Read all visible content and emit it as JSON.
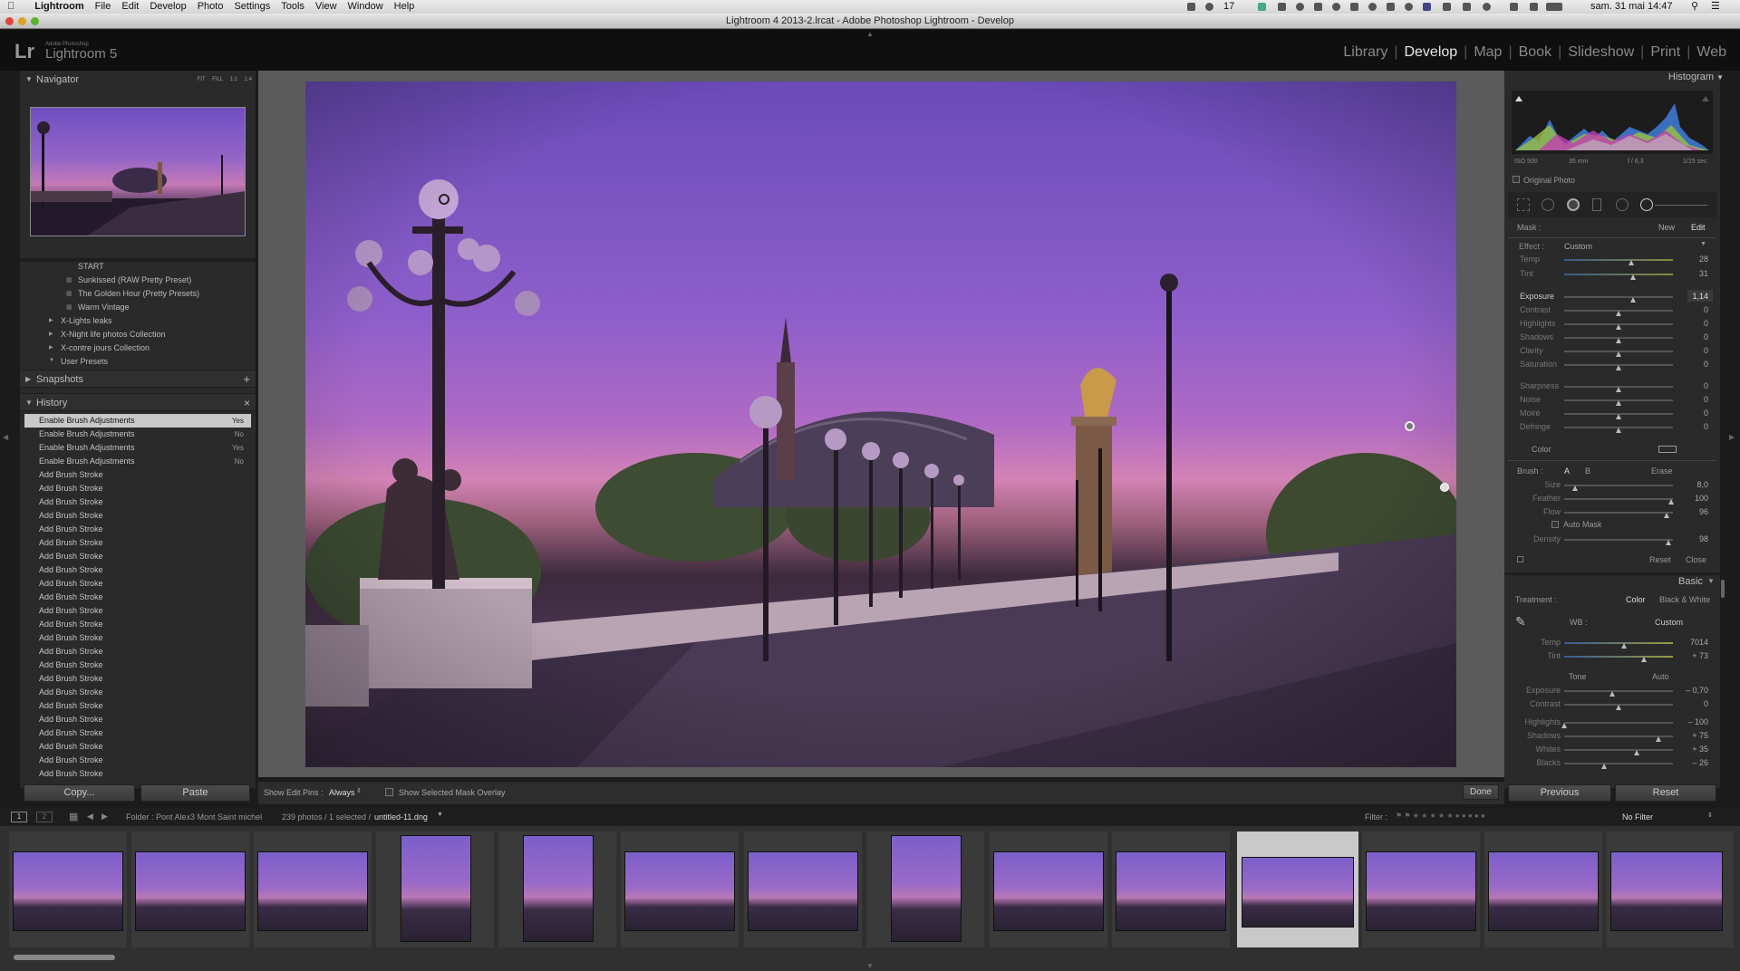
{
  "menubar": {
    "app": "Lightroom",
    "items": [
      "File",
      "Edit",
      "Develop",
      "Photo",
      "Settings",
      "Tools",
      "View",
      "Window",
      "Help"
    ],
    "badge": "17",
    "clock": "sam. 31 mai  14:47"
  },
  "window": {
    "title": "Lightroom 4 2013-2.lrcat - Adobe Photoshop Lightroom - Develop"
  },
  "header": {
    "logo_mark": "Lr",
    "logo_small": "Adobe Photoshop",
    "logo_name": "Lightroom 5",
    "modules": [
      "Library",
      "Develop",
      "Map",
      "Book",
      "Slideshow",
      "Print",
      "Web"
    ],
    "active_module": "Develop"
  },
  "left": {
    "navigator": {
      "title": "Navigator",
      "zoom_options": [
        "FIT",
        "FILL",
        "1:1",
        "1:4"
      ]
    },
    "presets": {
      "items": [
        "START",
        "Sunkissed (RAW Pretty Preset)",
        "The Golden Hour (Pretty Presets)",
        "Warm Vintage"
      ],
      "folders": [
        "X-Lights leaks",
        "X-Night life  photos Collection",
        "X-contre jours Collection",
        "User Presets"
      ]
    },
    "snapshots": {
      "title": "Snapshots",
      "add": "+"
    },
    "history": {
      "title": "History",
      "close": "×",
      "rows": [
        {
          "label": "Enable Brush Adjustments",
          "state": "Yes"
        },
        {
          "label": "Enable Brush Adjustments",
          "state": "No"
        },
        {
          "label": "Enable Brush Adjustments",
          "state": "Yes"
        },
        {
          "label": "Enable Brush Adjustments",
          "state": "No"
        },
        {
          "label": "Add Brush Stroke",
          "state": ""
        },
        {
          "label": "Add Brush Stroke",
          "state": ""
        },
        {
          "label": "Add Brush Stroke",
          "state": ""
        },
        {
          "label": "Add Brush Stroke",
          "state": ""
        },
        {
          "label": "Add Brush Stroke",
          "state": ""
        },
        {
          "label": "Add Brush Stroke",
          "state": ""
        },
        {
          "label": "Add Brush Stroke",
          "state": ""
        },
        {
          "label": "Add Brush Stroke",
          "state": ""
        },
        {
          "label": "Add Brush Stroke",
          "state": ""
        },
        {
          "label": "Add Brush Stroke",
          "state": ""
        },
        {
          "label": "Add Brush Stroke",
          "state": ""
        },
        {
          "label": "Add Brush Stroke",
          "state": ""
        },
        {
          "label": "Add Brush Stroke",
          "state": ""
        },
        {
          "label": "Add Brush Stroke",
          "state": ""
        },
        {
          "label": "Add Brush Stroke",
          "state": ""
        },
        {
          "label": "Add Brush Stroke",
          "state": ""
        },
        {
          "label": "Add Brush Stroke",
          "state": ""
        },
        {
          "label": "Add Brush Stroke",
          "state": ""
        },
        {
          "label": "Add Brush Stroke",
          "state": ""
        },
        {
          "label": "Add Brush Stroke",
          "state": ""
        },
        {
          "label": "Add Brush Stroke",
          "state": ""
        },
        {
          "label": "Add Brush Stroke",
          "state": ""
        },
        {
          "label": "Add Brush Stroke",
          "state": ""
        }
      ]
    },
    "copy_label": "Copy...",
    "paste_label": "Paste"
  },
  "toolbar": {
    "show_edit_pins": "Show Edit Pins :",
    "pins_value": "Always",
    "mask_overlay": "Show Selected Mask Overlay",
    "done": "Done"
  },
  "right": {
    "histogram": {
      "title": "Histogram",
      "iso": "ISO 500",
      "focal": "35 mm",
      "aperture": "f / 6,3",
      "shutter": "1/15 sec",
      "original": "Original Photo"
    },
    "mask": {
      "label": "Mask :",
      "new": "New",
      "edit": "Edit"
    },
    "effect": {
      "label": "Effect :",
      "value": "Custom"
    },
    "sliders1": [
      {
        "name": "Temp",
        "value": "28",
        "pos": 0.62
      },
      {
        "name": "Tint",
        "value": "31",
        "pos": 0.63
      }
    ],
    "exposure": {
      "name": "Exposure",
      "value": "1,14",
      "pos": 0.63
    },
    "sliders2": [
      {
        "name": "Contrast",
        "value": "0",
        "pos": 0.5
      },
      {
        "name": "Highlights",
        "value": "0",
        "pos": 0.5
      },
      {
        "name": "Shadows",
        "value": "0",
        "pos": 0.5
      },
      {
        "name": "Clarity",
        "value": "0",
        "pos": 0.5
      },
      {
        "name": "Saturation",
        "value": "0",
        "pos": 0.5
      }
    ],
    "sliders3": [
      {
        "name": "Sharpness",
        "value": "0",
        "pos": 0.5
      },
      {
        "name": "Noise",
        "value": "0",
        "pos": 0.5
      },
      {
        "name": "Moiré",
        "value": "0",
        "pos": 0.5
      },
      {
        "name": "Defringe",
        "value": "0",
        "pos": 0.5
      }
    ],
    "color_label": "Color",
    "brush": {
      "label": "Brush :",
      "a": "A",
      "b": "B",
      "erase": "Erase",
      "sliders": [
        {
          "name": "Size",
          "value": "8,0",
          "pos": 0.1
        },
        {
          "name": "Feather",
          "value": "100",
          "pos": 0.98
        },
        {
          "name": "Flow",
          "value": "96",
          "pos": 0.94
        }
      ],
      "auto_mask": "Auto Mask",
      "density": {
        "name": "Density",
        "value": "98",
        "pos": 0.96
      },
      "reset": "Reset",
      "close": "Close"
    },
    "basic": {
      "title": "Basic",
      "treatment": "Treatment :",
      "color": "Color",
      "bw": "Black & White",
      "wb": "WB :",
      "wb_value": "Custom",
      "wb_sliders": [
        {
          "name": "Temp",
          "value": "7014",
          "pos": 0.55
        },
        {
          "name": "Tint",
          "value": "+ 73",
          "pos": 0.73
        }
      ],
      "tone": "Tone",
      "auto": "Auto",
      "tone_sliders": [
        {
          "name": "Exposure",
          "value": "– 0,70",
          "pos": 0.44
        },
        {
          "name": "Contrast",
          "value": "0",
          "pos": 0.5
        }
      ],
      "tone_sliders2": [
        {
          "name": "Highlights",
          "value": "– 100",
          "pos": 0.0
        },
        {
          "name": "Shadows",
          "value": "+ 75",
          "pos": 0.87
        },
        {
          "name": "Whites",
          "value": "+ 35",
          "pos": 0.67
        },
        {
          "name": "Blacks",
          "value": "– 26",
          "pos": 0.37
        }
      ]
    },
    "previous": "Previous",
    "reset": "Reset"
  },
  "filmstrip": {
    "page1": "1",
    "page2": "2",
    "folder": "Folder : Pont Alex3 Mont Saint michel",
    "count": "239 photos / 1 selected /",
    "filename": "untitled-11.dng",
    "filter_label": "Filter :",
    "filter_value": "No Filter"
  }
}
